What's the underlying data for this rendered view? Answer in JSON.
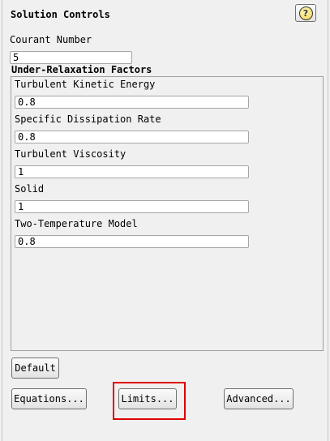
{
  "panel": {
    "title": "Solution Controls",
    "help_icon_name": "help-icon",
    "help_glyph": "?"
  },
  "courant": {
    "label": "Courant Number",
    "value": "5"
  },
  "under_relaxation": {
    "title": "Under-Relaxation Factors",
    "items": [
      {
        "label": "Turbulent Kinetic Energy",
        "value": "0.8"
      },
      {
        "label": "Specific Dissipation Rate",
        "value": "0.8"
      },
      {
        "label": "Turbulent Viscosity",
        "value": "1"
      },
      {
        "label": "Solid",
        "value": "1"
      },
      {
        "label": "Two-Temperature Model",
        "value": "0.8"
      }
    ]
  },
  "buttons": {
    "default": "Default",
    "equations": "Equations...",
    "limits": "Limits...",
    "advanced": "Advanced..."
  },
  "highlight_color": "#e00000"
}
